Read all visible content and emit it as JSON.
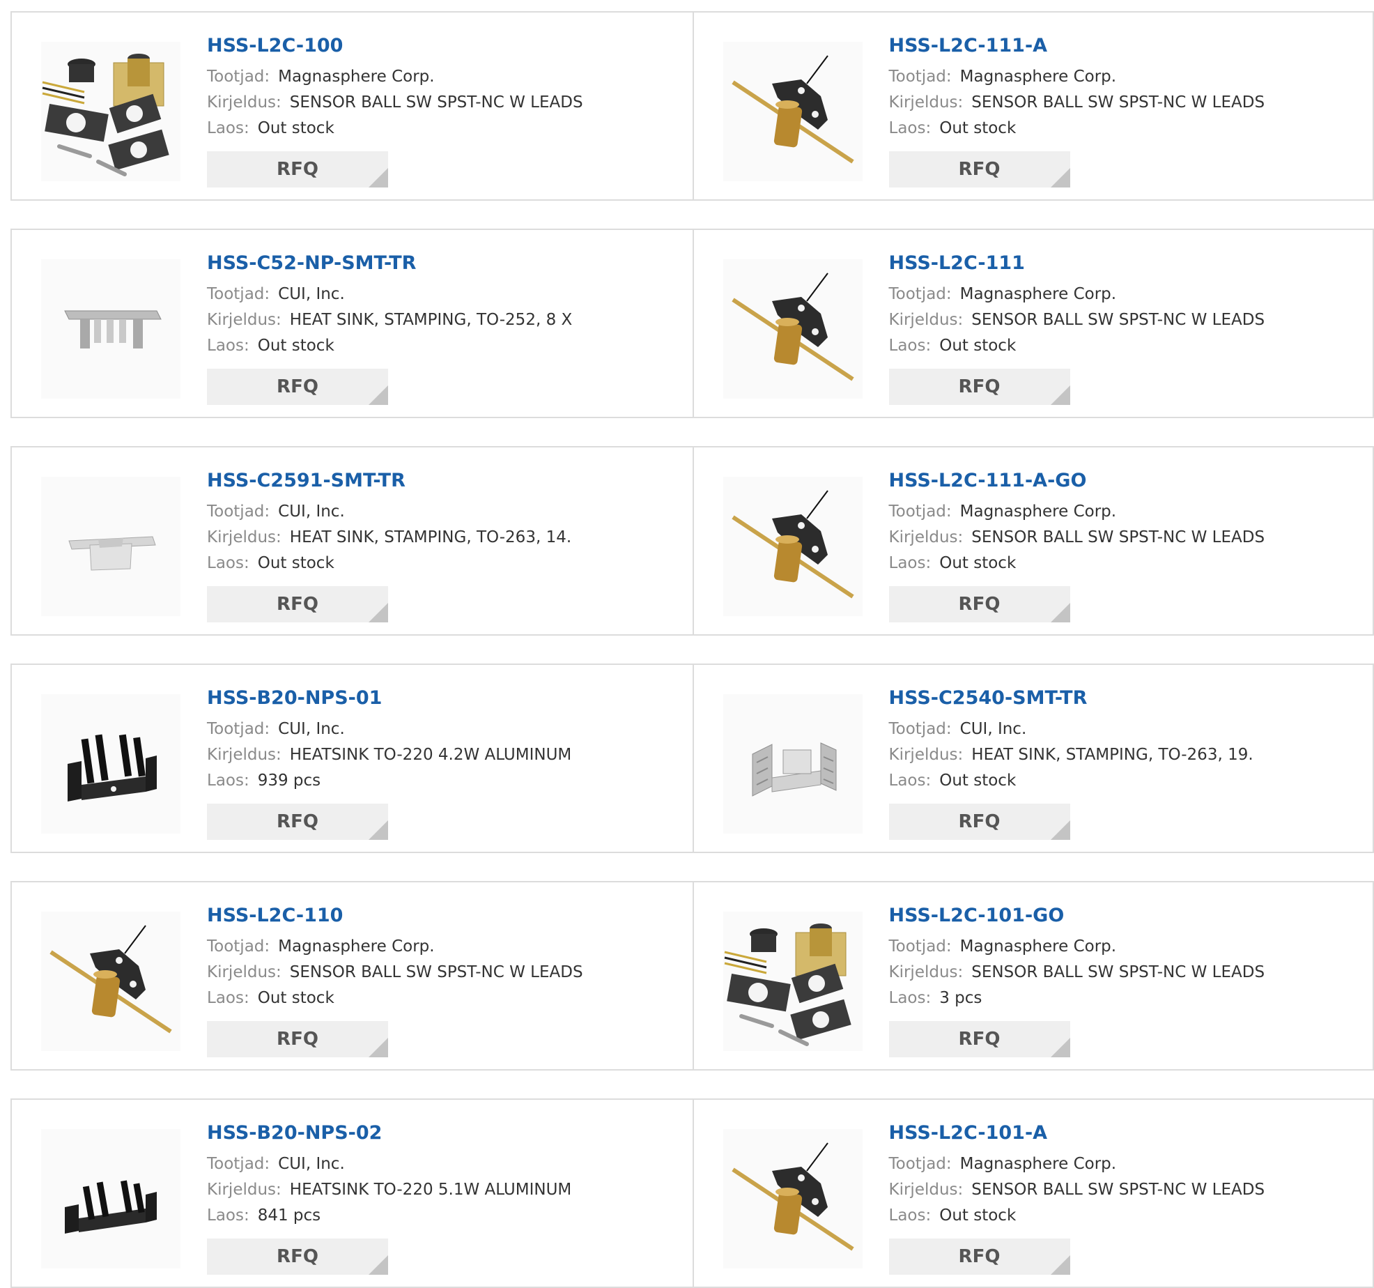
{
  "labels": {
    "manufacturer": "Tootjad:",
    "description": "Kirjeldus:",
    "stock": "Laos:",
    "rfq": "RFQ"
  },
  "rows": [
    [
      {
        "part": "HSS-L2C-100",
        "manufacturer": "Magnasphere Corp.",
        "description": "SENSOR BALL SW SPST-NC W LEADS",
        "stock": "Out stock",
        "image_icon": "sensor-kit-icon"
      },
      {
        "part": "HSS-L2C-111-A",
        "manufacturer": "Magnasphere Corp.",
        "description": "SENSOR BALL SW SPST-NC W LEADS",
        "stock": "Out stock",
        "image_icon": "sensor-mount-icon"
      }
    ],
    [
      {
        "part": "HSS-C52-NP-SMT-TR",
        "manufacturer": "CUI, Inc.",
        "description": "HEAT SINK, STAMPING, TO-252, 8 X",
        "stock": "Out stock",
        "image_icon": "stamped-heatsink-icon"
      },
      {
        "part": "HSS-L2C-111",
        "manufacturer": "Magnasphere Corp.",
        "description": "SENSOR BALL SW SPST-NC W LEADS",
        "stock": "Out stock",
        "image_icon": "sensor-mount-icon"
      }
    ],
    [
      {
        "part": "HSS-C2591-SMT-TR",
        "manufacturer": "CUI, Inc.",
        "description": "HEAT SINK, STAMPING, TO-263, 14.",
        "stock": "Out stock",
        "image_icon": "stamped-heatsink-icon"
      },
      {
        "part": "HSS-L2C-111-A-GO",
        "manufacturer": "Magnasphere Corp.",
        "description": "SENSOR BALL SW SPST-NC W LEADS",
        "stock": "Out stock",
        "image_icon": "sensor-mount-icon"
      }
    ],
    [
      {
        "part": "HSS-B20-NPS-01",
        "manufacturer": "CUI, Inc.",
        "description": "HEATSINK TO-220 4.2W ALUMINUM",
        "stock": "939 pcs",
        "image_icon": "black-heatsink-icon"
      },
      {
        "part": "HSS-C2540-SMT-TR",
        "manufacturer": "CUI, Inc.",
        "description": "HEAT SINK, STAMPING, TO-263, 19.",
        "stock": "Out stock",
        "image_icon": "silver-heatsink-icon"
      }
    ],
    [
      {
        "part": "HSS-L2C-110",
        "manufacturer": "Magnasphere Corp.",
        "description": "SENSOR BALL SW SPST-NC W LEADS",
        "stock": "Out stock",
        "image_icon": "sensor-mount-icon"
      },
      {
        "part": "HSS-L2C-101-GO",
        "manufacturer": "Magnasphere Corp.",
        "description": "SENSOR BALL SW SPST-NC W LEADS",
        "stock": "3 pcs",
        "image_icon": "sensor-kit-icon"
      }
    ],
    [
      {
        "part": "HSS-B20-NPS-02",
        "manufacturer": "CUI, Inc.",
        "description": "HEATSINK TO-220 5.1W ALUMINUM",
        "stock": "841 pcs",
        "image_icon": "black-heatsink-icon"
      },
      {
        "part": "HSS-L2C-101-A",
        "manufacturer": "Magnasphere Corp.",
        "description": "SENSOR BALL SW SPST-NC W LEADS",
        "stock": "Out stock",
        "image_icon": "sensor-mount-icon"
      }
    ]
  ]
}
